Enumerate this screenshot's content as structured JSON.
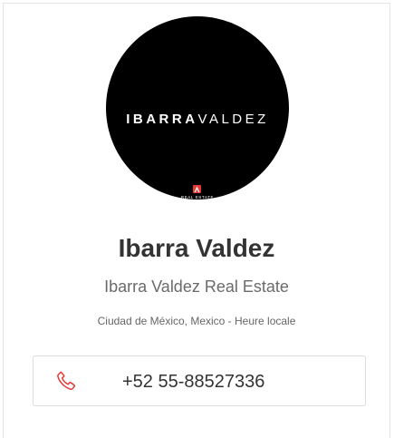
{
  "profile": {
    "logo": {
      "wordmark_bold": "IBARRA",
      "wordmark_light": "VALDEZ",
      "sub_label": "REAL ESTATE",
      "background_color": "#000000",
      "accent_color": "#e53935"
    },
    "name": "Ibarra Valdez",
    "company": "Ibarra Valdez Real Estate",
    "location": "Ciudad de México, Mexico - Heure locale"
  },
  "contact": {
    "phone_icon": "phone-icon",
    "phone_icon_color": "#e53935",
    "phone_number": "+52 55-88527336"
  }
}
